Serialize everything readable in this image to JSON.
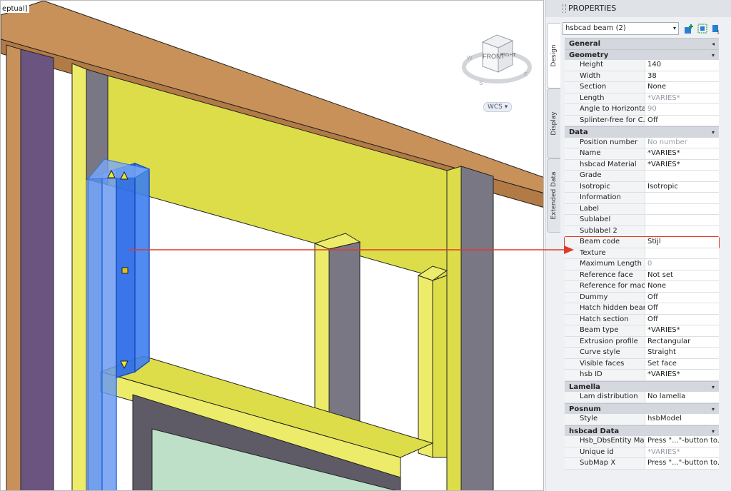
{
  "viewport": {
    "view_label": "eptual]",
    "viewcube": {
      "front": "FRONT",
      "right": "RIGHT",
      "compass": [
        "W",
        "S",
        "E"
      ]
    },
    "wcs_label": "WCS",
    "wcs_arrow": "▾"
  },
  "palette": {
    "title": "PROPERTIES",
    "tabs": [
      "Design",
      "Display",
      "Extended Data"
    ],
    "selector_value": "hsbcad beam (2)",
    "selector_arrow": "▾",
    "toolbar_icons": [
      "quick-select-icon",
      "select-objects-icon",
      "toggle-pickadd-icon"
    ],
    "categories": [
      {
        "name": "General",
        "collapsed": true,
        "rows": []
      },
      {
        "name": "Geometry",
        "collapsed": false,
        "rows": [
          {
            "name": "Height",
            "value": "140",
            "grey": false
          },
          {
            "name": "Width",
            "value": "38",
            "grey": false
          },
          {
            "name": "Section",
            "value": "None",
            "grey": false
          },
          {
            "name": "Length",
            "value": "*VARIES*",
            "grey": true
          },
          {
            "name": "Angle to Horizonta...",
            "value": "90",
            "grey": true
          },
          {
            "name": "Splinter-free for C...",
            "value": "Off",
            "grey": false
          }
        ]
      },
      {
        "name": "Data",
        "collapsed": false,
        "rows": [
          {
            "name": "Position number",
            "value": "No number",
            "grey": true
          },
          {
            "name": "Name",
            "value": "*VARIES*",
            "grey": false
          },
          {
            "name": "hsbcad Material",
            "value": "*VARIES*",
            "grey": false
          },
          {
            "name": "Grade",
            "value": "",
            "grey": false
          },
          {
            "name": "Isotropic",
            "value": "Isotropic",
            "grey": false
          },
          {
            "name": "Information",
            "value": "",
            "grey": false
          },
          {
            "name": "Label",
            "value": "",
            "grey": false
          },
          {
            "name": "Sublabel",
            "value": "",
            "grey": false
          },
          {
            "name": "Sublabel 2",
            "value": "",
            "grey": false
          },
          {
            "name": "Beam code",
            "value": "Stijl",
            "grey": false,
            "highlight": true
          },
          {
            "name": "Texture",
            "value": "",
            "grey": false
          },
          {
            "name": "Maximum Length",
            "value": "0",
            "grey": true
          },
          {
            "name": "Reference face",
            "value": "Not set",
            "grey": false
          },
          {
            "name": "Reference for mac...",
            "value": "None",
            "grey": false
          },
          {
            "name": "Dummy",
            "value": "Off",
            "grey": false
          },
          {
            "name": "Hatch hidden beam",
            "value": "Off",
            "grey": false
          },
          {
            "name": "Hatch section",
            "value": "Off",
            "grey": false
          },
          {
            "name": "Beam type",
            "value": "*VARIES*",
            "grey": false
          },
          {
            "name": "Extrusion profile",
            "value": "Rectangular",
            "grey": false
          },
          {
            "name": "Curve style",
            "value": "Straight",
            "grey": false
          },
          {
            "name": "Visible faces",
            "value": "Set face",
            "grey": false
          },
          {
            "name": "hsb ID",
            "value": "*VARIES*",
            "grey": false
          }
        ]
      },
      {
        "name": "Lamella",
        "collapsed": false,
        "rows": [
          {
            "name": "Lam distribution",
            "value": "No lamella",
            "grey": false
          }
        ]
      },
      {
        "name": "Posnum",
        "collapsed": false,
        "rows": [
          {
            "name": "Style",
            "value": "hsbModel",
            "grey": false
          }
        ]
      },
      {
        "name": "hsbcad Data",
        "collapsed": false,
        "rows": [
          {
            "name": "Hsb_DbsEntity Map",
            "value": "Press \"...\"-button to...",
            "grey": false
          },
          {
            "name": "Unique id",
            "value": "*VARIES*",
            "grey": true
          },
          {
            "name": "SubMap X",
            "value": "Press \"...\"-button to...",
            "grey": false
          }
        ]
      }
    ]
  },
  "colors": {
    "timber": "#c8915a",
    "timber_dark": "#8a5a2e",
    "yellow": "#dddd4a",
    "yellow_light": "#ecec6a",
    "grey_face": "#7a7784",
    "purple": "#6b5480",
    "selection": "#2f6fe8",
    "highlight": "#e03a2a",
    "glass": "#bfe0c8"
  }
}
